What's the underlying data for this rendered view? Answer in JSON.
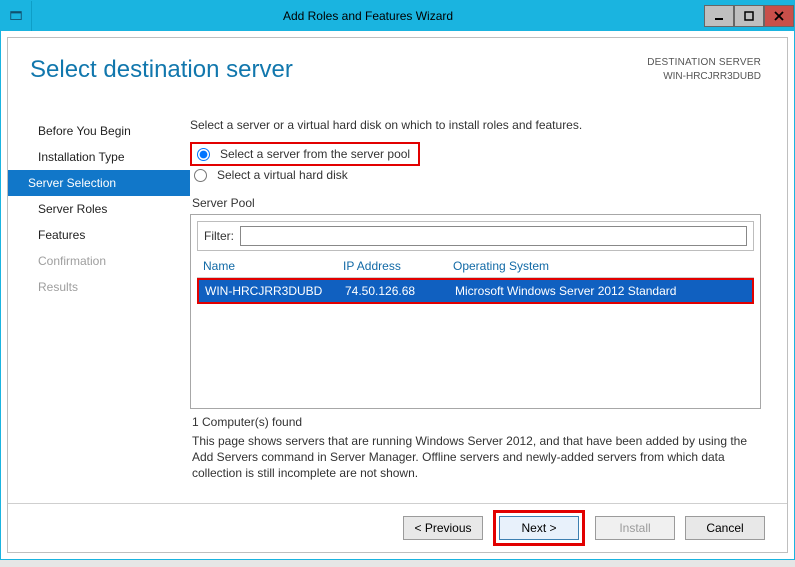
{
  "window": {
    "title": "Add Roles and Features Wizard"
  },
  "page": {
    "heading": "Select destination server",
    "dest_label": "DESTINATION SERVER",
    "dest_value": "WIN-HRCJRR3DUBD",
    "instruction": "Select a server or a virtual hard disk on which to install roles and features.",
    "radio_pool": "Select a server from the server pool",
    "radio_vhd": "Select a virtual hard disk",
    "server_pool_label": "Server Pool",
    "filter_label": "Filter:",
    "filter_value": "",
    "columns": {
      "name": "Name",
      "ip": "IP Address",
      "os": "Operating System"
    },
    "rows": [
      {
        "name": "WIN-HRCJRR3DUBD",
        "ip": "74.50.126.68",
        "os": "Microsoft Windows Server 2012 Standard"
      }
    ],
    "count_text": "1 Computer(s) found",
    "note": "This page shows servers that are running Windows Server 2012, and that have been added by using the Add Servers command in Server Manager. Offline servers and newly-added servers from which data collection is still incomplete are not shown."
  },
  "nav": {
    "items": [
      {
        "label": "Before You Begin",
        "state": "normal"
      },
      {
        "label": "Installation Type",
        "state": "normal"
      },
      {
        "label": "Server Selection",
        "state": "selected"
      },
      {
        "label": "Server Roles",
        "state": "normal"
      },
      {
        "label": "Features",
        "state": "normal"
      },
      {
        "label": "Confirmation",
        "state": "disabled"
      },
      {
        "label": "Results",
        "state": "disabled"
      }
    ]
  },
  "footer": {
    "previous": "< Previous",
    "next": "Next >",
    "install": "Install",
    "cancel": "Cancel"
  }
}
